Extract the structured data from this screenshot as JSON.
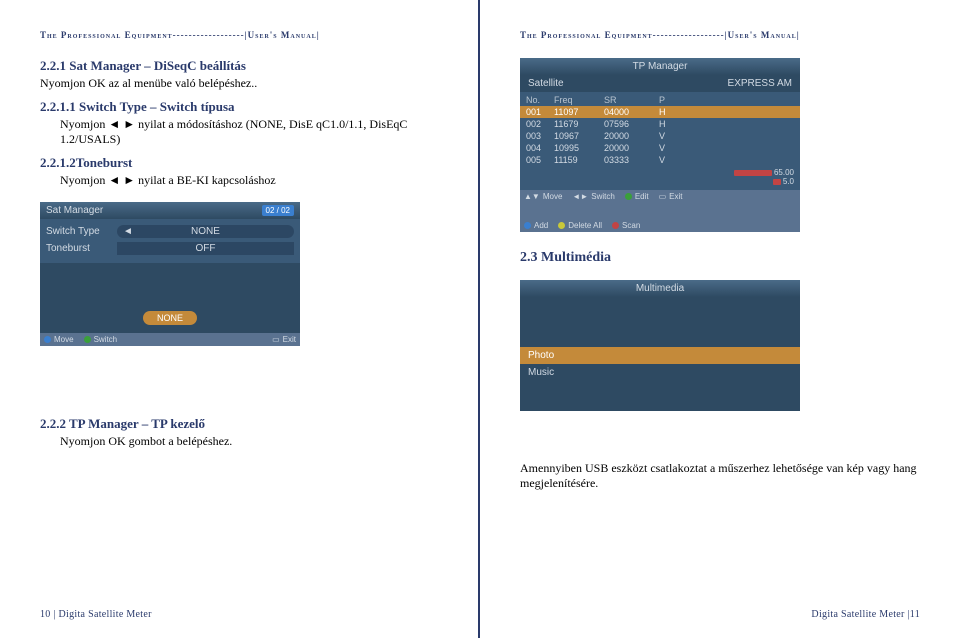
{
  "headerText": "The Professional Equipment------------------|User's Manual|",
  "leftPage": {
    "s221_title": "2.2.1 Sat Manager – DiSeqC beállítás",
    "s221_body": "Nyomjon OK az al menübe való belépéshez..",
    "s2211_title": "2.2.1.1 Switch Type – Switch típusa",
    "s2211_body": "Nyomjon ◄ ► nyilat a módosításhoz (NONE, DisE qC1.0/1.1, DisEqC 1.2/USALS)",
    "s2212_title": "2.2.1.2Toneburst",
    "s2212_body": "Nyomjon ◄ ►   nyilat a BE-KI kapcsoláshoz",
    "satManager": {
      "title": "Sat Manager",
      "badge": "02 / 02",
      "switchTypeLabel": "Switch Type",
      "switchTypeValue": "NONE",
      "toneburstLabel": "Toneburst",
      "toneburstValue": "OFF",
      "noneBtn": "NONE",
      "foot_move": "Move",
      "foot_switch": "Switch",
      "foot_exit": "Exit"
    },
    "s222_title": "2.2.2 TP Manager – TP kezelő",
    "s222_body": "Nyomjon OK gombot a belépéshez.",
    "footer": "10 | Digita Satellite Meter"
  },
  "rightPage": {
    "tpManager": {
      "title": "TP Manager",
      "satLabel": "Satellite",
      "satValue": "EXPRESS AM",
      "cols": {
        "no": "No.",
        "freq": "Freq",
        "sr": "SR",
        "p": "P"
      },
      "rows": [
        {
          "no": "001",
          "freq": "11097",
          "sr": "04000",
          "p": "H",
          "sel": true
        },
        {
          "no": "002",
          "freq": "11679",
          "sr": "07596",
          "p": "H"
        },
        {
          "no": "003",
          "freq": "10967",
          "sr": "20000",
          "p": "V"
        },
        {
          "no": "004",
          "freq": "10995",
          "sr": "20000",
          "p": "V"
        },
        {
          "no": "005",
          "freq": "11159",
          "sr": "03333",
          "p": "V"
        }
      ],
      "sigS": "65.00",
      "sigQ": "5.0",
      "foot_move": "Move",
      "foot_switch": "Switch",
      "foot_edit": "Edit",
      "foot_exit": "Exit",
      "foot_add": "Add",
      "foot_delete": "Delete All",
      "foot_scan": "Scan"
    },
    "s23_title": "2.3 Multimédia",
    "multimedia": {
      "title": "Multimedia",
      "photo": "Photo",
      "music": "Music"
    },
    "usb_text": "Amennyiben USB eszközt csatlakoztat a műszerhez lehetősége van kép vagy hang megjelenítésére.",
    "footer": "Digita Satellite Meter |11"
  }
}
